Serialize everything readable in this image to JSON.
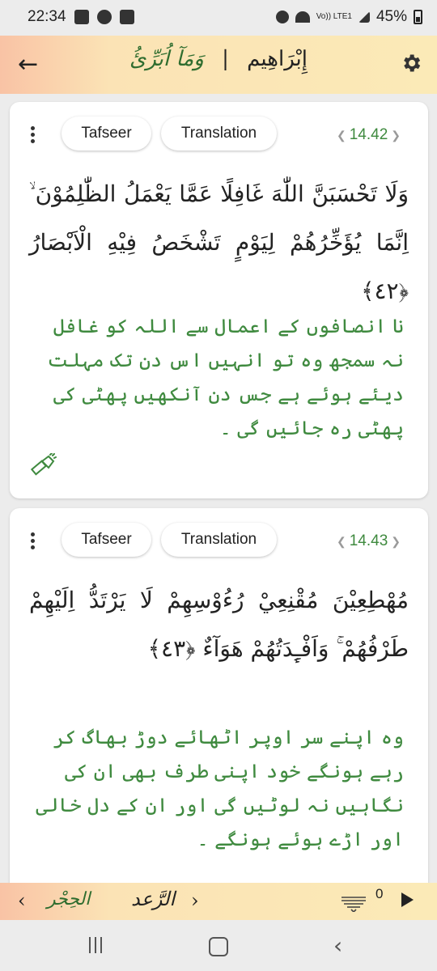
{
  "status_bar": {
    "time": "22:34",
    "network": "Vo)) LTE1",
    "battery": "45%"
  },
  "header": {
    "back_icon": "←",
    "para_name": "وَمَآ اُبَرِّئُ",
    "surah_name": "إِبْرَاهِيم",
    "separator": "|"
  },
  "verses": [
    {
      "tafseer_label": "Tafseer",
      "translation_label": "Translation",
      "reference": "14.42",
      "arabic": "وَلَا تَحْسَبَنَّ اللّٰهَ غَافِلًا عَمَّا يَعْمَلُ الظّٰلِمُوْنَ ۙ اِنَّمَا يُؤَخِّرُهُمْ لِيَوْمٍ تَشْخَصُ فِيْهِ الْاَبْصَارُ ﴿٤٢﴾",
      "translation_urdu": "نا انصافوں کے اعمال سے اللہ کو غافل نہ سمجھ وہ تو انہیں اس دن تک مہلت دیئے ہوئے ہے جس دن آنکھیں پھٹی کی پھٹی رہ جائیں گی ۔"
    },
    {
      "tafseer_label": "Tafseer",
      "translation_label": "Translation",
      "reference": "14.43",
      "arabic": "مُهْطِعِيْنَ مُقْنِعِيْ رُءُوْسِهِمْ لَا يَرْتَدُّ اِلَيْهِمْ طَرْفُهُمْ ۚ وَاَفْـِٕدَتُهُمْ هَوَآءٌ ﴿٤٣﴾",
      "translation_urdu": "وہ اپنے سر اوپر اٹھائے دوڑ بھاگ کر رہے ہونگے خود اپنی طرف بھی ان کی نگاہیں نہ لوٹیں گی اور ان کے دل خالی اور اڑے ہوئے ہونگے ۔"
    }
  ],
  "bottom_bar": {
    "prev_arrow": "‹",
    "prev_surah": "الحِجْر",
    "current_surah": "الرَّعد",
    "next_arrow": "›",
    "playlist_count": "0"
  },
  "colors": {
    "accent_green": "#3f8a3f",
    "header_gradient_start": "#f9c3a5",
    "header_gradient_end": "#fbeab7"
  },
  "icons": [
    "back-arrow-icon",
    "settings-gear-icon",
    "more-vert-icon",
    "flashlight-icon",
    "playlist-icon",
    "play-icon"
  ]
}
